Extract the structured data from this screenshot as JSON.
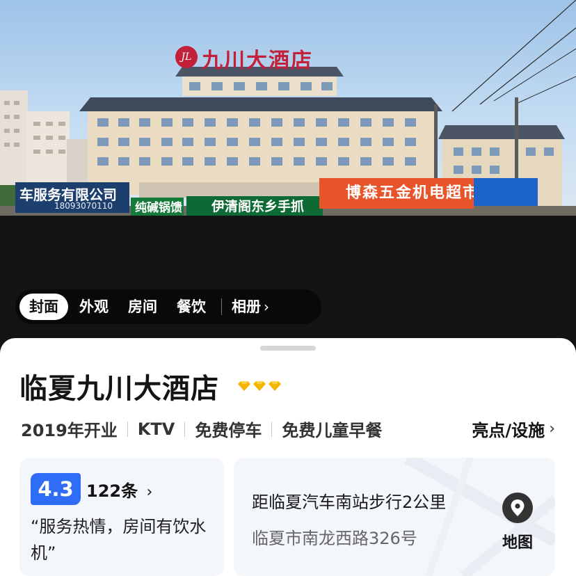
{
  "hero": {
    "sign_logo": "JL",
    "sign_text": "九川大酒店",
    "shop_signs": {
      "left": "车服务有限公司",
      "left_phone": "18093070110",
      "orange": "博森五金机电超市",
      "green1": "纯碱锅馈",
      "green2": "伊清阁东乡手抓"
    }
  },
  "tabs": {
    "items": [
      {
        "label": "封面",
        "active": true
      },
      {
        "label": "外观",
        "active": false
      },
      {
        "label": "房间",
        "active": false
      },
      {
        "label": "餐饮",
        "active": false
      }
    ],
    "album_label": "相册",
    "album_icon": "chevron-right-icon"
  },
  "hotel": {
    "name": "临夏九川大酒店",
    "diamond_count": 3,
    "diamond_color": "#f5b400"
  },
  "features": [
    "2019年开业",
    "KTV",
    "免费停车",
    "免费儿童早餐"
  ],
  "highlights_label": "亮点/设施",
  "rating": {
    "score": "4.3",
    "count": "122条",
    "quote": "“服务热情，房间有饮水机”",
    "accent": "#2f6df6"
  },
  "location": {
    "distance": "距临夏汽车南站步行2公里",
    "address": "临夏市南龙西路326号",
    "map_label": "地图",
    "map_icon": "location-pin-icon"
  }
}
